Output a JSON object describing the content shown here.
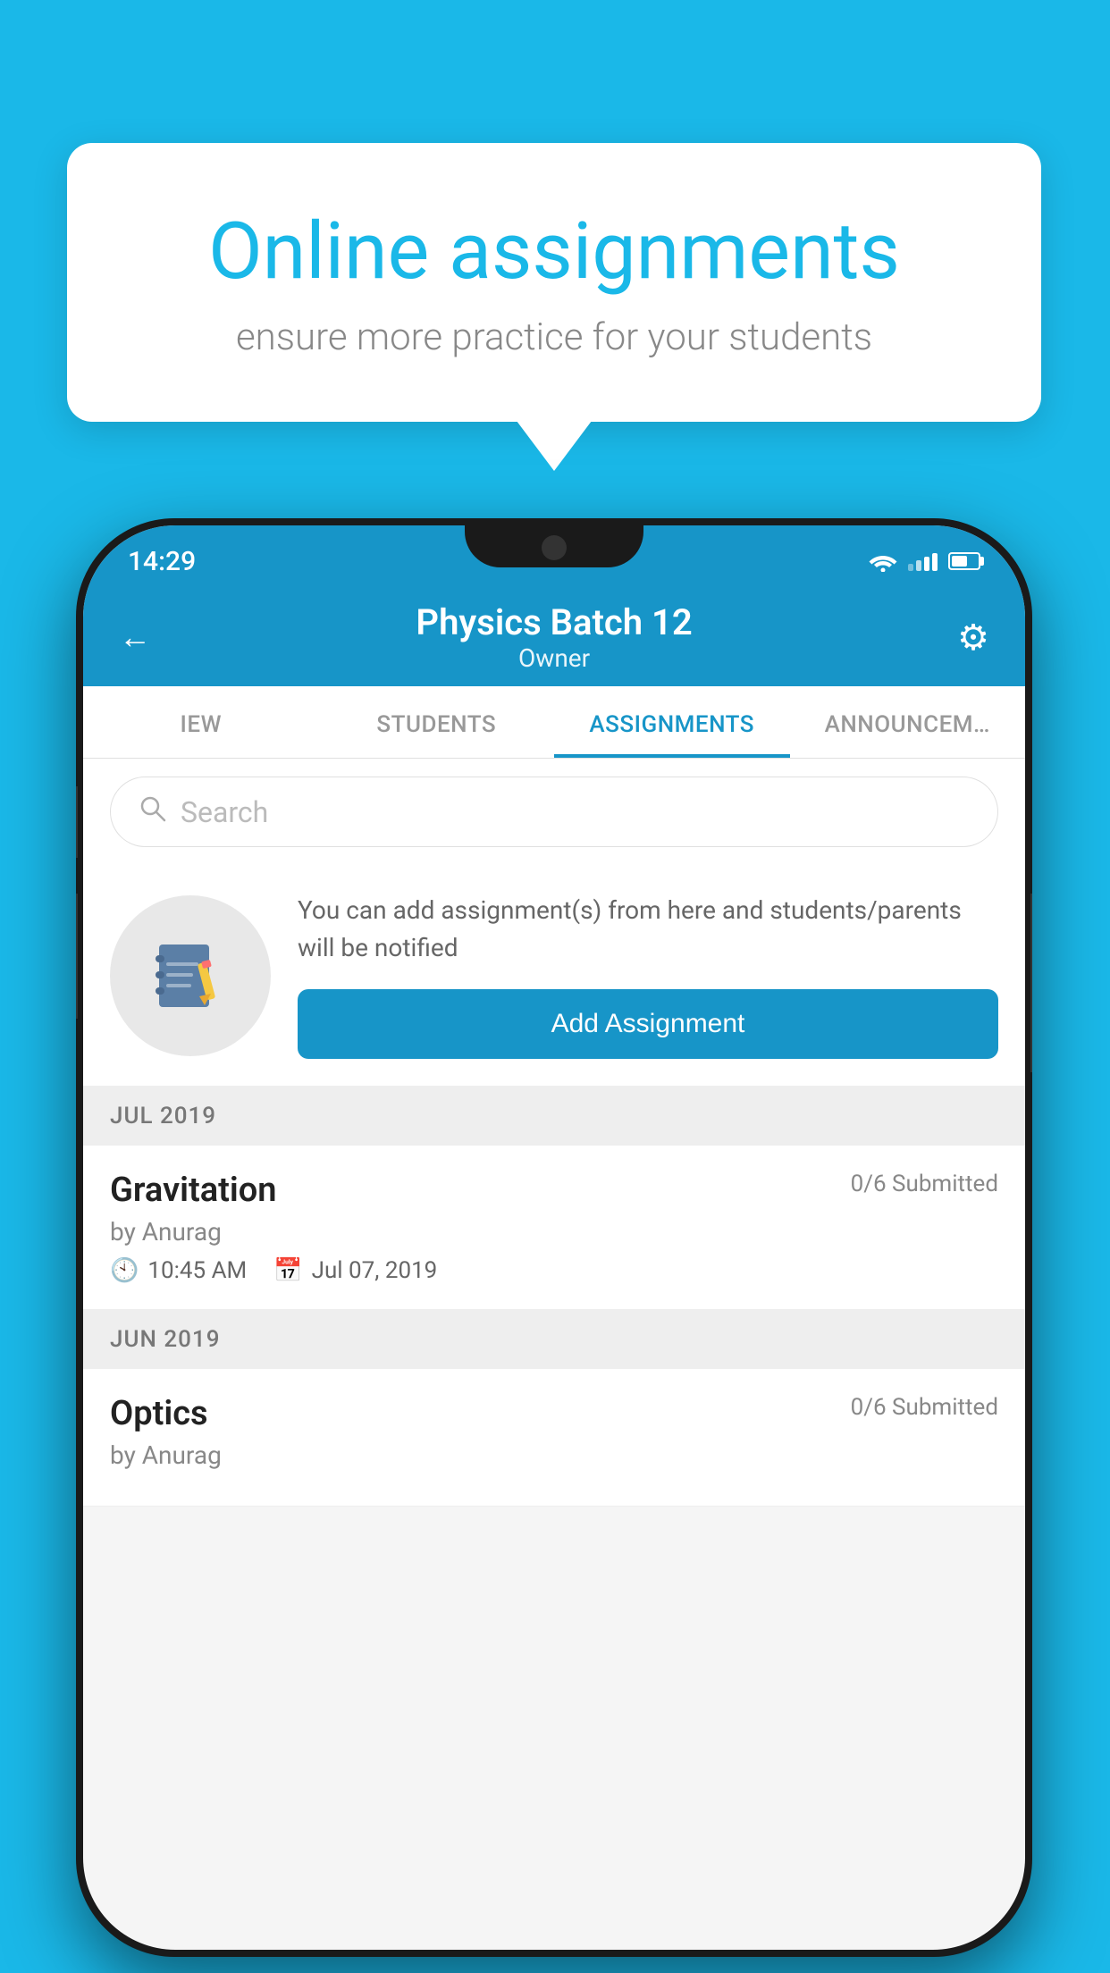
{
  "background_color": "#1ab8e8",
  "speech_bubble": {
    "title": "Online assignments",
    "subtitle": "ensure more practice for your students"
  },
  "phone": {
    "status_bar": {
      "time": "14:29"
    },
    "header": {
      "title": "Physics Batch 12",
      "subtitle": "Owner",
      "back_label": "←",
      "gear_label": "⚙"
    },
    "tabs": [
      {
        "label": "IEW",
        "active": false
      },
      {
        "label": "STUDENTS",
        "active": false
      },
      {
        "label": "ASSIGNMENTS",
        "active": true
      },
      {
        "label": "ANNOUNCEM…",
        "active": false
      }
    ],
    "search": {
      "placeholder": "Search"
    },
    "info_card": {
      "description": "You can add assignment(s) from here and students/parents will be notified",
      "button_label": "Add Assignment"
    },
    "assignments": [
      {
        "month": "JUL 2019",
        "items": [
          {
            "name": "Gravitation",
            "submitted": "0/6 Submitted",
            "author": "by Anurag",
            "time": "10:45 AM",
            "date": "Jul 07, 2019"
          }
        ]
      },
      {
        "month": "JUN 2019",
        "items": [
          {
            "name": "Optics",
            "submitted": "0/6 Submitted",
            "author": "by Anurag",
            "time": "",
            "date": ""
          }
        ]
      }
    ]
  }
}
